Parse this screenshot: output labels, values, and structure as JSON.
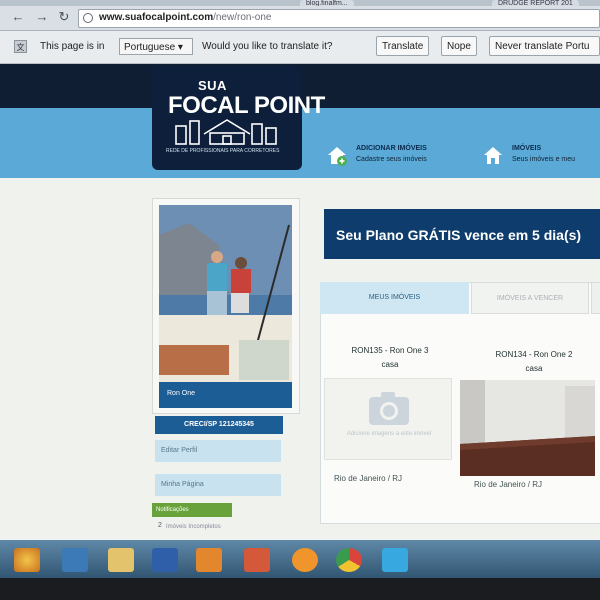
{
  "browser": {
    "tabs": [
      "blog.finalfm...",
      "DRUDGE REPORT 201"
    ],
    "url_domain": "www.suafocalpoint.com",
    "url_path": "/new/ron-one"
  },
  "translate_bar": {
    "prefix": "This page is in",
    "language": "Portuguese",
    "question": "Would you like to translate it?",
    "translate_label": "Translate",
    "nope_label": "Nope",
    "never_label": "Never translate Portu"
  },
  "site": {
    "logo_sua": "SUA",
    "logo_main": "FOCAL POINT",
    "logo_tagline": "REDE DE PROFISSIONAIS PARA CORRETORES",
    "menu": [
      {
        "title": "ADICIONAR IMÓVEIS",
        "subtitle": "Cadastre seus imóveis"
      },
      {
        "title": "IMÓVEIS",
        "subtitle": "Seus imóveis e meu"
      }
    ]
  },
  "profile": {
    "name": "Ron One",
    "creci": "CRECI/SP 121245345",
    "links": [
      "Editar Perfil",
      "Minha Página"
    ],
    "notification_badge": "Notificações",
    "notification_count": "2",
    "notification_text": "Imóveis Incompletos"
  },
  "main": {
    "plan_banner": "Seu Plano GRÁTIS vence em 5 dia(s)",
    "tabs": [
      "MEUS IMÓVEIS",
      "IMÓVEIS A VENCER"
    ],
    "properties": [
      {
        "title": "RON135 - Ron One 3",
        "type": "casa",
        "no_image_text": "Adicione imagens a este imóvel",
        "location": "Rio de Janeiro / RJ"
      },
      {
        "title": "RON134 - Ron One 2",
        "type": "casa",
        "location": "Rio de Janeiro / RJ"
      }
    ]
  },
  "colors": {
    "header_dark": "#0f1e33",
    "band_blue": "#5aa9d6",
    "plan_banner": "#0e3c6c",
    "profile_bar": "#1d5d95",
    "notification_green": "#67a33a"
  }
}
